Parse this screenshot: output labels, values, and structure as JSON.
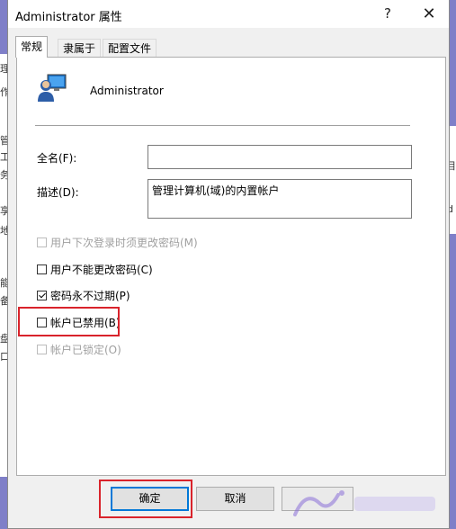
{
  "window": {
    "title": "Administrator 属性",
    "help_label": "?",
    "close_label": "✕"
  },
  "tabs": [
    {
      "label": "常规",
      "active": true
    },
    {
      "label": "隶属于",
      "active": false
    },
    {
      "label": "配置文件",
      "active": false
    }
  ],
  "user": {
    "name": "Administrator"
  },
  "fields": {
    "fullname": {
      "label": "全名(F):",
      "value": ""
    },
    "description": {
      "label": "描述(D):",
      "value": "管理计算机(域)的内置帐户"
    }
  },
  "options": [
    {
      "label": "用户下次登录时须更改密码(M)",
      "checked": false,
      "disabled": true
    },
    {
      "label": "用户不能更改密码(C)",
      "checked": false,
      "disabled": false
    },
    {
      "label": "密码永不过期(P)",
      "checked": true,
      "disabled": false
    },
    {
      "label": "帐户已禁用(B)",
      "checked": false,
      "disabled": false
    },
    {
      "label": "帐户已锁定(O)",
      "checked": false,
      "disabled": true
    }
  ],
  "buttons": {
    "ok": "确定",
    "cancel": "取消"
  },
  "background_glimpse": {
    "left": [
      "理",
      "作",
      "管",
      "工",
      "务",
      "享",
      "地",
      "能",
      "备",
      "盘",
      "口"
    ],
    "right": [
      "目",
      "d"
    ]
  },
  "accent_colors": {
    "highlight": "#d9232b",
    "focus": "#0078d7",
    "desktop": "#7f7fc8"
  }
}
